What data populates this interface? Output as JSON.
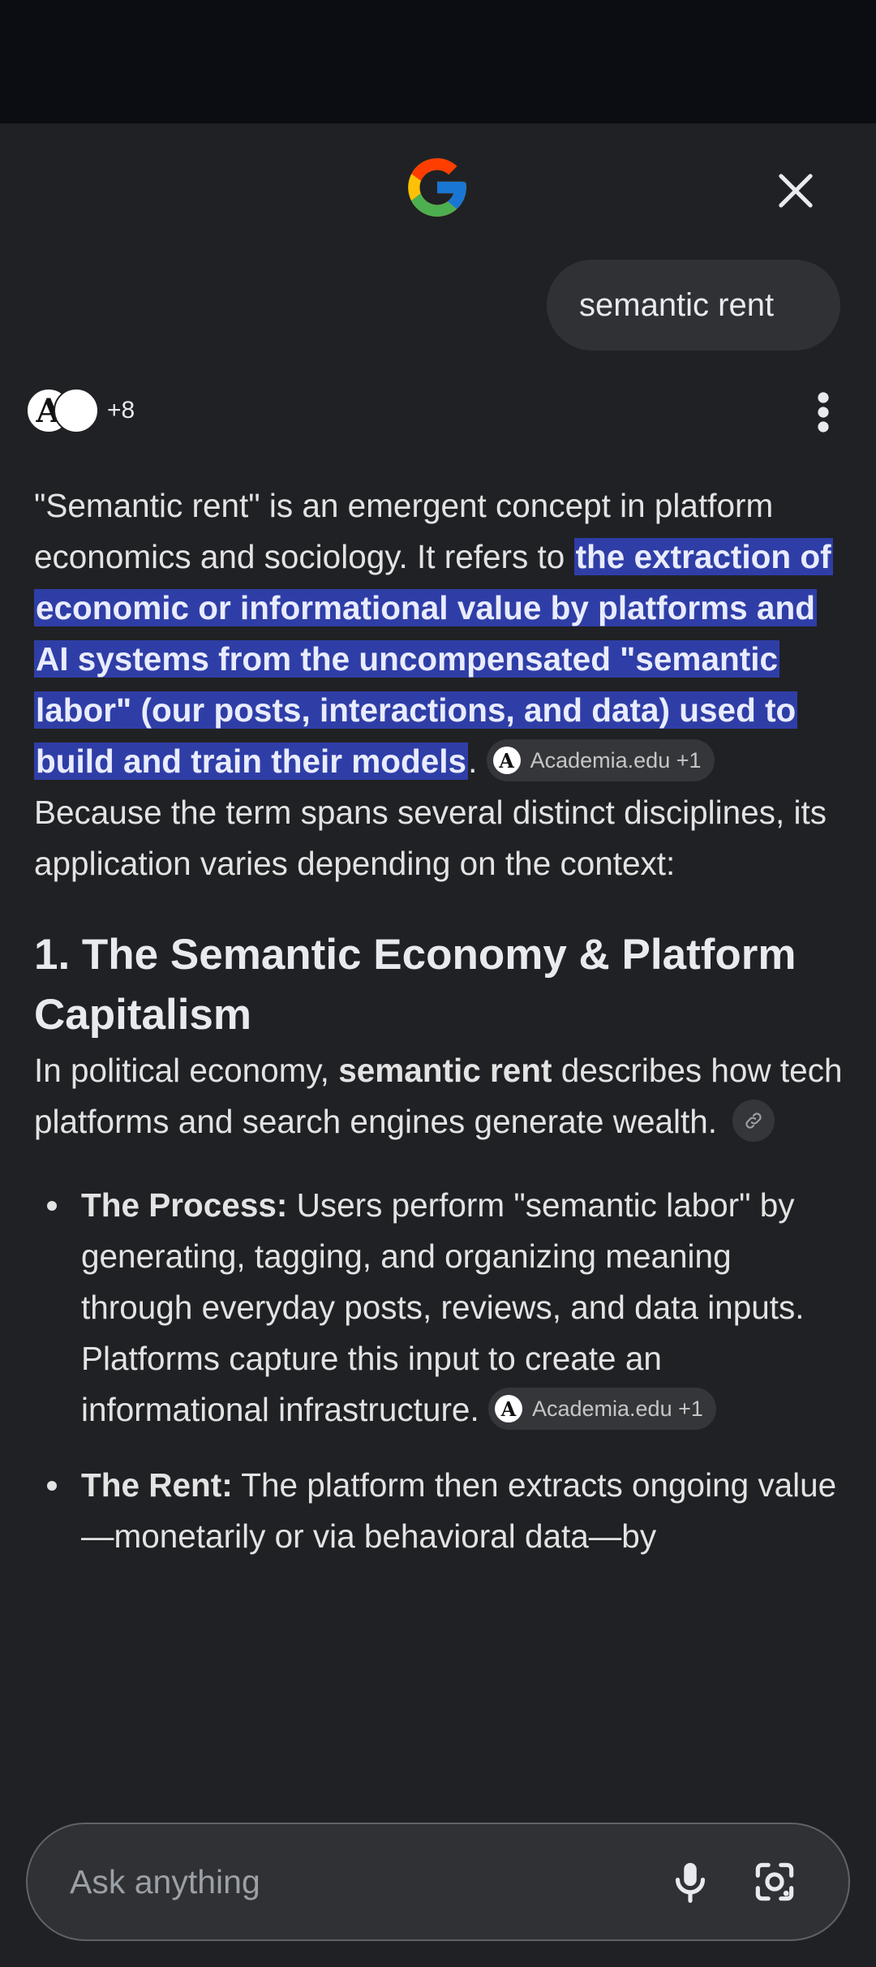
{
  "colors": {
    "background": "#202124",
    "status_bar": "#0c0d12",
    "highlight": "#2f3ea6",
    "chip": "#35363a",
    "text": "#e3e3e3"
  },
  "header": {
    "logo_icon": "google-g-icon",
    "close_icon": "close-icon"
  },
  "query": {
    "text": "semantic rent"
  },
  "sources": {
    "count_label": "+8",
    "menu_icon": "more-vert-icon"
  },
  "answer": {
    "intro_before": "\"Semantic rent\" is an emergent concept in platform economics and sociology. It refers to ",
    "intro_highlight_a": "the extraction of economic or informational value",
    "intro_highlight_b": " by platforms and AI systems from the uncompensated \"semantic labor\" (our posts, interactions, and data) used to build and train their models",
    "intro_after": ".",
    "intro_chip": "Academia.edu +1",
    "context": "Because the term spans several distinct disciplines, its application varies depending on the context:",
    "section_title": "1. The Semantic Economy & Platform Capitalism",
    "section_intro_a": "In political economy, ",
    "section_intro_bold": "semantic rent",
    "section_intro_b": " describes how tech platforms and search engines generate wealth.",
    "bullets": [
      {
        "label": "The Process:",
        "text": " Users perform \"semantic labor\" by generating, tagging, and organizing meaning through everyday posts, reviews, and data inputs. Platforms capture this input to create an informational infrastructure. ",
        "chip": "Academia.edu +1"
      },
      {
        "label": "The Rent:",
        "text": " The platform then extracts ongoing value—monetarily or via behavioral data—by"
      }
    ]
  },
  "input": {
    "placeholder": "Ask anything",
    "mic_icon": "mic-icon",
    "lens_icon": "google-lens-icon"
  }
}
